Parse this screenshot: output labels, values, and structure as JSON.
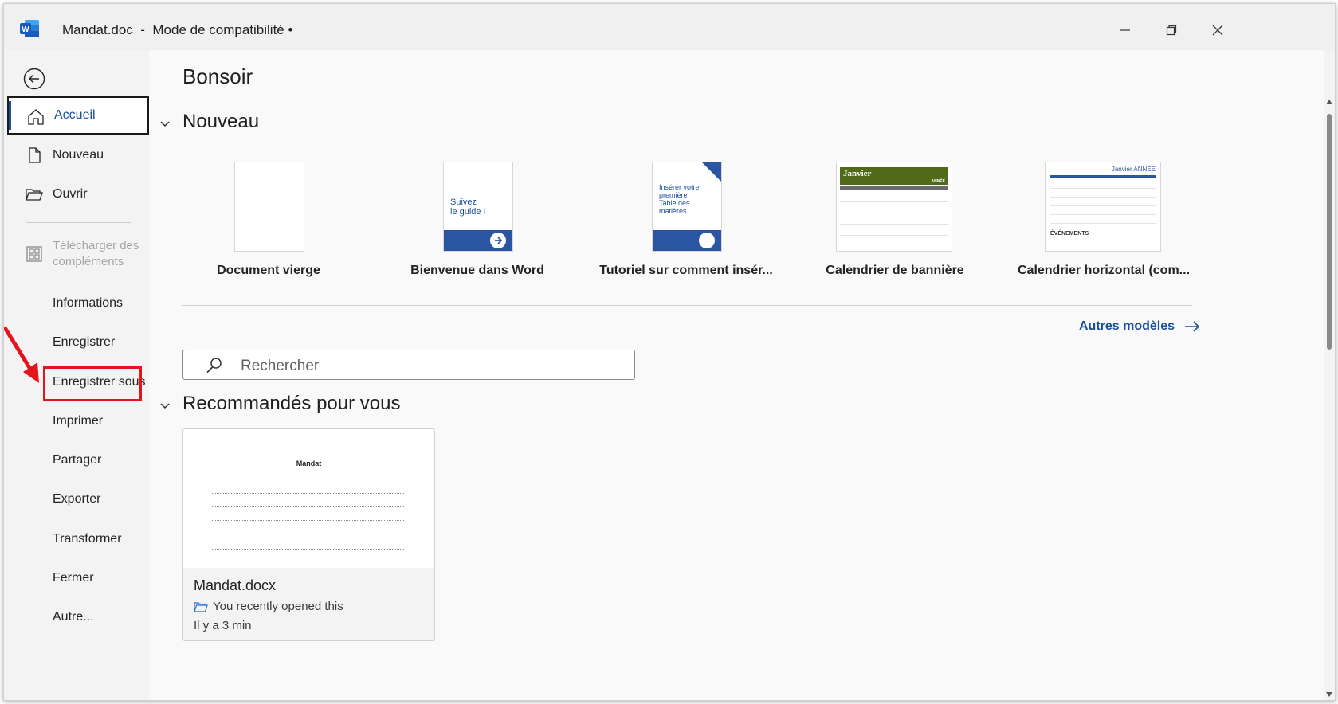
{
  "window": {
    "title": "Mandat.doc  -  Mode de compatibilité •",
    "controls": {
      "minimize": "minimize",
      "restore": "restore",
      "close": "close"
    }
  },
  "sidebar": {
    "items": [
      {
        "label": "Accueil",
        "icon": "home-icon"
      },
      {
        "label": "Nouveau",
        "icon": "new-document-icon"
      },
      {
        "label": "Ouvrir",
        "icon": "folder-open-icon"
      },
      {
        "label": "Télécharger des compléments",
        "icon": "addins-grid-icon"
      },
      {
        "label": "Informations"
      },
      {
        "label": "Enregistrer"
      },
      {
        "label": "Enregistrer sous"
      },
      {
        "label": "Imprimer"
      },
      {
        "label": "Partager"
      },
      {
        "label": "Exporter"
      },
      {
        "label": "Transformer"
      },
      {
        "label": "Fermer"
      },
      {
        "label": "Autre..."
      }
    ]
  },
  "main": {
    "greeting": "Bonsoir",
    "new_section": {
      "title": "Nouveau",
      "templates": [
        {
          "name": "Document vierge"
        },
        {
          "name": "Bienvenue dans Word",
          "thumb_text": "Suivez\nle guide !"
        },
        {
          "name": "Tutoriel sur comment insér...",
          "thumb_text": "Insérer votre\npremière\nTable des\nmatières"
        },
        {
          "name": "Calendrier de bannière",
          "thumb_month": "Janvier",
          "thumb_year": "ANNÉE"
        },
        {
          "name": "Calendrier horizontal (com...",
          "thumb_month": "Janvier ANNÉE",
          "thumb_events": "ÉVÉNEMENTS"
        }
      ],
      "more_templates": "Autres modèles"
    },
    "search": {
      "placeholder": "Rechercher"
    },
    "recommended": {
      "title": "Recommandés pour vous",
      "card": {
        "preview_title": "Mandat",
        "file_name": "Mandat.docx",
        "subtitle": "You recently opened this",
        "time": "Il y a 3 min"
      }
    }
  },
  "colors": {
    "accent": "#1b4f9b",
    "highlight": "#e3141b",
    "calendar_green": "#4f6b1a"
  }
}
